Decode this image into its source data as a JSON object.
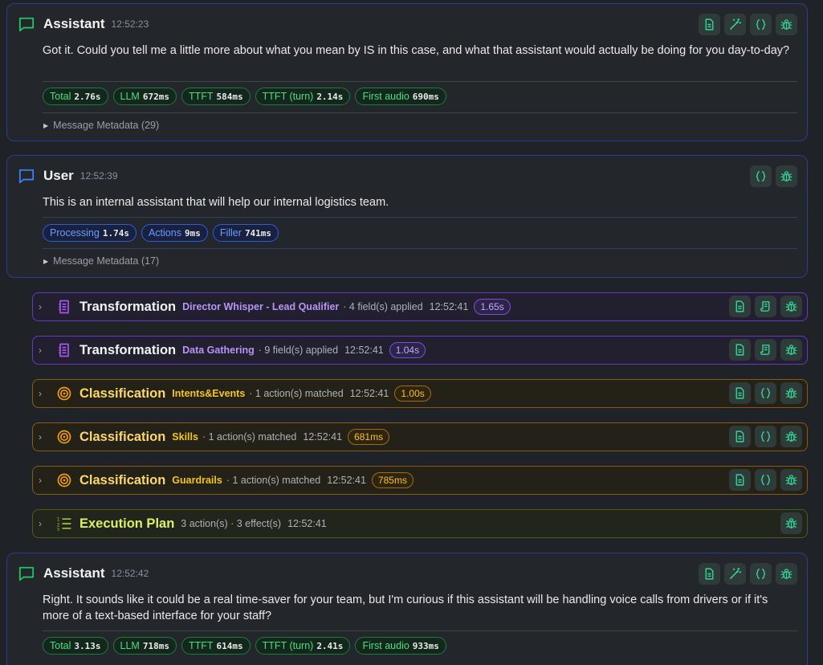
{
  "messages": [
    {
      "role": "Assistant",
      "time": "12:52:23",
      "text": "Got it. Could you tell me a little more about what you mean by IS in this case, and what that assistant would actually be doing for you day-to-day?",
      "metrics": [
        {
          "label": "Total",
          "value": "2.76s"
        },
        {
          "label": "LLM",
          "value": "672ms"
        },
        {
          "label": "TTFT",
          "value": "584ms"
        },
        {
          "label": "TTFT (turn)",
          "value": "2.14s"
        },
        {
          "label": "First audio",
          "value": "690ms"
        }
      ],
      "metadata": "Message Metadata (29)"
    },
    {
      "role": "User",
      "time": "12:52:39",
      "text": "This is an internal assistant that will help our internal logistics team.",
      "metrics": [
        {
          "label": "Processing",
          "value": "1.74s"
        },
        {
          "label": "Actions",
          "value": "9ms"
        },
        {
          "label": "Filler",
          "value": "741ms"
        }
      ],
      "metadata": "Message Metadata (17)"
    },
    {
      "role": "Assistant",
      "time": "12:52:42",
      "text": "Right. It sounds like it could be a real time-saver for your team, but I'm curious if this assistant will be handling voice calls from drivers or if it's more of a text-based interface for your staff?",
      "metrics": [
        {
          "label": "Total",
          "value": "3.13s"
        },
        {
          "label": "LLM",
          "value": "718ms"
        },
        {
          "label": "TTFT",
          "value": "614ms"
        },
        {
          "label": "TTFT (turn)",
          "value": "2.41s"
        },
        {
          "label": "First audio",
          "value": "933ms"
        }
      ]
    }
  ],
  "steps": [
    {
      "title": "Transformation",
      "name": "Director Whisper - Lead Qualifier",
      "desc": "· 4 field(s) applied",
      "time": "12:52:41",
      "duration": "1.65s"
    },
    {
      "title": "Transformation",
      "name": "Data Gathering",
      "desc": "· 9 field(s) applied",
      "time": "12:52:41",
      "duration": "1.04s"
    },
    {
      "title": "Classification",
      "name": "Intents&Events",
      "desc": "· 1 action(s) matched",
      "time": "12:52:41",
      "duration": "1.00s"
    },
    {
      "title": "Classification",
      "name": "Skills",
      "desc": "· 1 action(s) matched",
      "time": "12:52:41",
      "duration": "681ms"
    },
    {
      "title": "Classification",
      "name": "Guardrails",
      "desc": "· 1 action(s) matched",
      "time": "12:52:41",
      "duration": "785ms"
    },
    {
      "title": "Execution Plan",
      "desc": "3 action(s) · 3 effect(s)",
      "time": "12:52:41"
    }
  ],
  "colors": {
    "assistant_icon": "#22c55e",
    "user_icon": "#3b82f6",
    "transformation": "#a855f7",
    "classification": "#f59e0b",
    "execution": "#a3c43a",
    "action_icon": "#34d399"
  }
}
